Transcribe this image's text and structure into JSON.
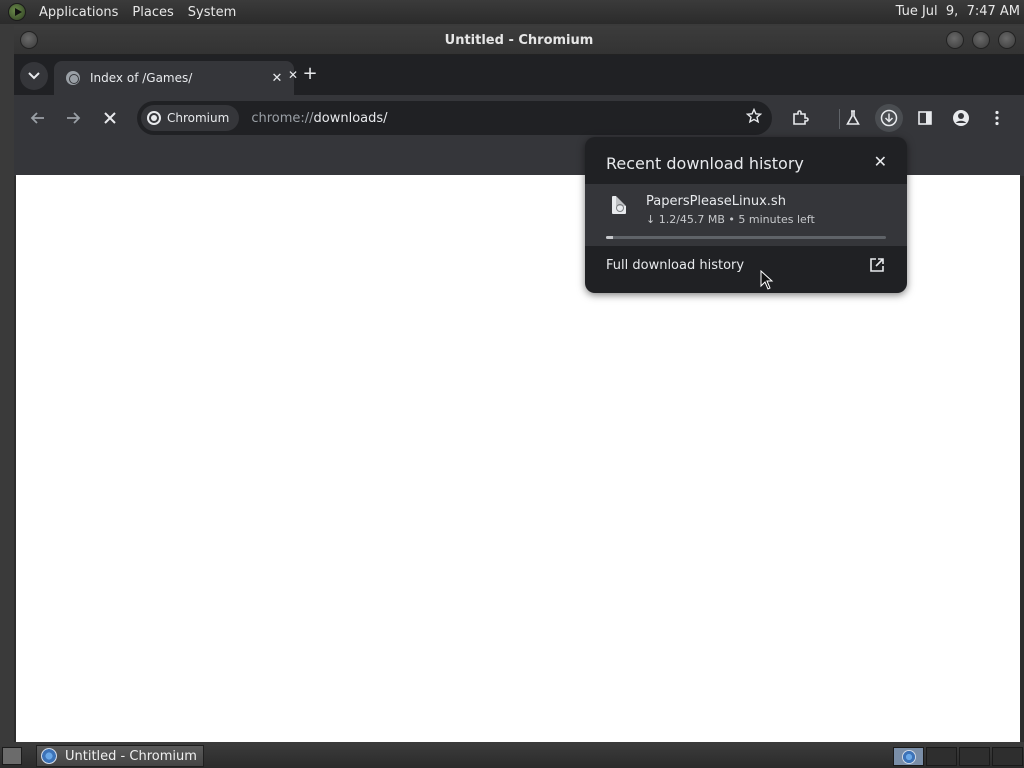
{
  "top_panel": {
    "menus": [
      "Applications",
      "Places",
      "System"
    ],
    "clock": "Tue Jul  9,  7:47 AM"
  },
  "window": {
    "title": "Untitled - Chromium"
  },
  "tabs": [
    {
      "title": "Index of /Games/",
      "close_label": "✕"
    }
  ],
  "new_tab_label": "+",
  "toolbar": {
    "chip_label": "Chromium",
    "url_scheme": "chrome://",
    "url_host": "downloads/"
  },
  "download_bubble": {
    "title": "Recent download history",
    "close_label": "✕",
    "item": {
      "filename": "PapersPleaseLinux.sh",
      "status": "↓ 1.2/45.7 MB • 5 minutes left",
      "progress_fraction": 0.026
    },
    "full_history_label": "Full download history"
  },
  "taskbar": {
    "task_label": "Untitled - Chromium"
  },
  "icons": {
    "back": "back-arrow-icon",
    "forward": "forward-arrow-icon",
    "stop": "stop-icon",
    "bookmark": "star-icon",
    "extensions": "puzzle-icon",
    "labs": "flask-icon",
    "downloads": "download-icon",
    "side_panel": "side-panel-icon",
    "profile": "profile-icon",
    "menu": "kebab-menu-icon"
  }
}
